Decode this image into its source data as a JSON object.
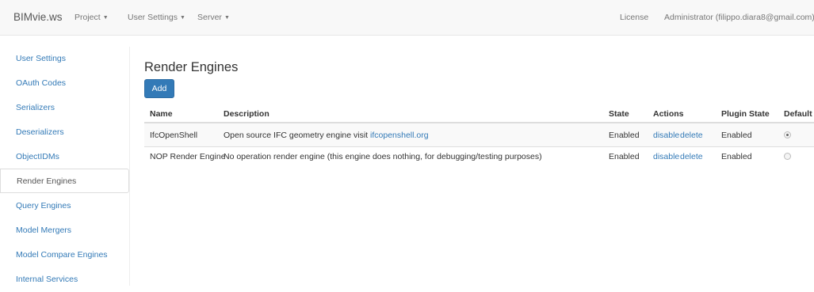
{
  "navbar": {
    "brand": "BIMvie.ws",
    "menus": [
      {
        "label": "Project"
      },
      {
        "label": "User Settings"
      },
      {
        "label": "Server"
      }
    ],
    "license": "License",
    "user": "Administrator (filippo.diara8@gmail.com)"
  },
  "sidebar": {
    "items": [
      {
        "label": "User Settings"
      },
      {
        "label": "OAuth Codes"
      },
      {
        "label": "Serializers"
      },
      {
        "label": "Deserializers"
      },
      {
        "label": "ObjectIDMs"
      },
      {
        "label": "Render Engines"
      },
      {
        "label": "Query Engines"
      },
      {
        "label": "Model Mergers"
      },
      {
        "label": "Model Compare Engines"
      },
      {
        "label": "Internal Services"
      }
    ],
    "active": "Render Engines"
  },
  "main": {
    "title": "Render Engines",
    "add_label": "Add",
    "table": {
      "headers": {
        "name": "Name",
        "description": "Description",
        "state": "State",
        "actions": "Actions",
        "plugin_state": "Plugin State",
        "default": "Default"
      },
      "rows": [
        {
          "name": "IfcOpenShell",
          "description": "Open source IFC geometry engine visit ",
          "description_link": "ifcopenshell.org",
          "state": "Enabled",
          "action_disable": "disable",
          "action_delete": "delete",
          "plugin_state": "Enabled",
          "default": true
        },
        {
          "name": "NOP Render Engine",
          "description": "No operation render engine (this engine does nothing, for debugging/testing purposes)",
          "description_link": "",
          "state": "Enabled",
          "action_disable": "disable",
          "action_delete": "delete",
          "plugin_state": "Enabled",
          "default": false
        }
      ]
    }
  },
  "colors": {
    "link": "#337ab7",
    "primary_button": "#337ab7",
    "navbar_bg": "#f8f8f8",
    "row_stripe": "#f9f9f9"
  }
}
